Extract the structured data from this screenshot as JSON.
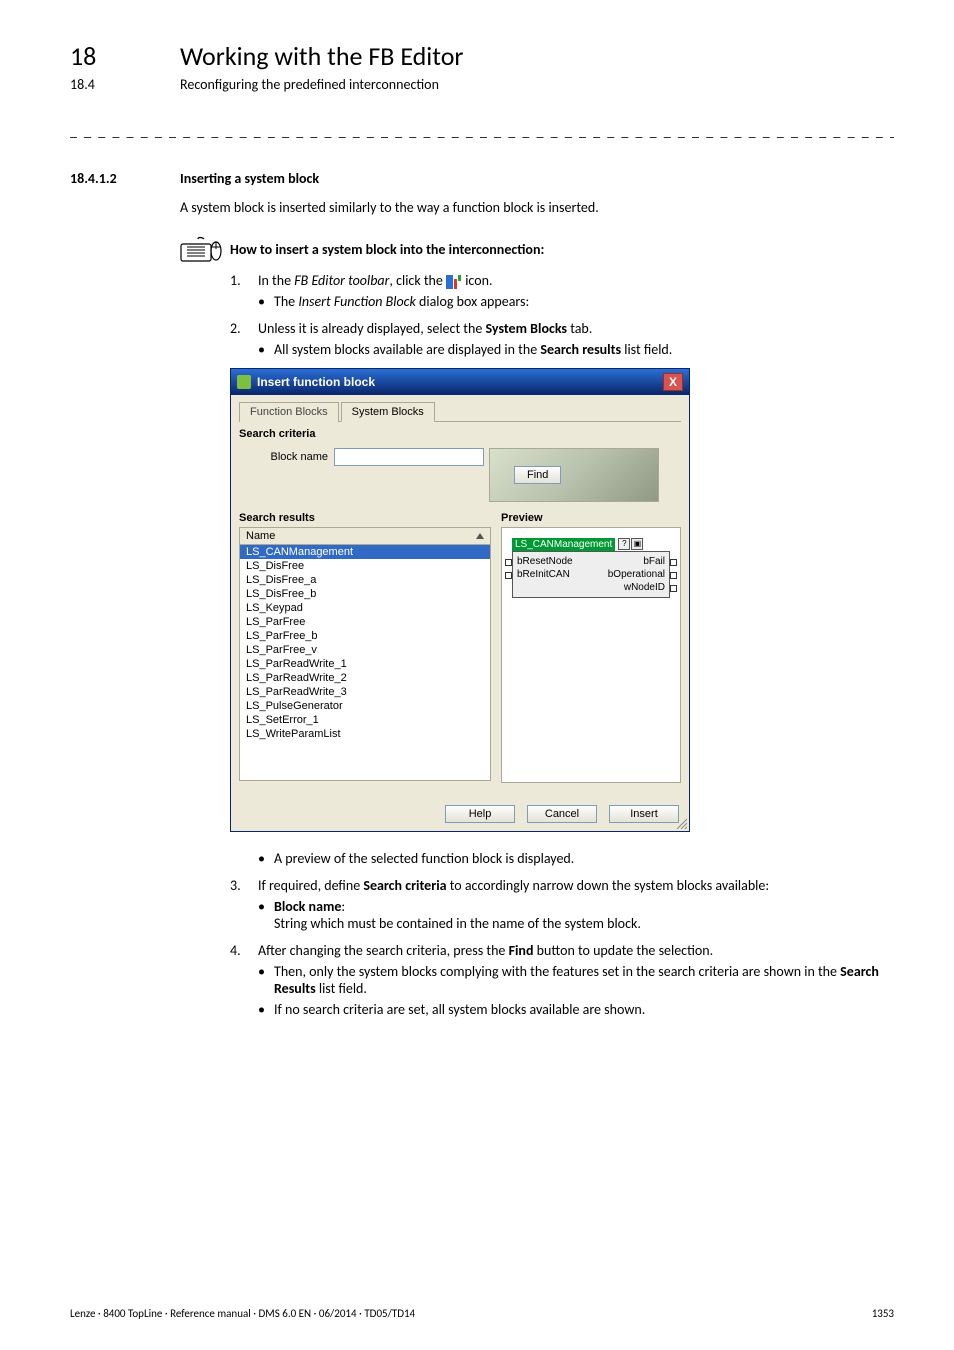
{
  "hdr": {
    "chapNo": "18",
    "chapTitle": "Working with the FB Editor",
    "secNo": "18.4",
    "secTitle": "Reconfiguring the predefined interconnection"
  },
  "subsec": {
    "no": "18.4.1.2",
    "title": "Inserting a system block"
  },
  "intro": "A system block is inserted similarly to the way a function block is inserted.",
  "howto": "How to insert a system block into the interconnection:",
  "step1": {
    "num": "1.",
    "pre": "In the ",
    "toolbar": "FB Editor toolbar",
    "mid": ", click the ",
    "post": " icon.",
    "b1a": "The ",
    "b1b": "Insert Function Block",
    "b1c": " dialog box appears:"
  },
  "step2": {
    "num": "2.",
    "pre": "Unless it is already displayed, select the ",
    "bold": "System Blocks",
    "post": " tab.",
    "b1a": "All system blocks available are displayed in the ",
    "b1b": "Search results",
    "b1c": " list field."
  },
  "dialog": {
    "title": "Insert function block",
    "close": "X",
    "tabFB": "Function Blocks",
    "tabSB": "System Blocks",
    "searchCriteria": "Search criteria",
    "blockName": "Block name",
    "findBtn": "Find",
    "searchResults": "Search results",
    "nameHdr": "Name",
    "items": [
      "LS_CANManagement",
      "LS_DisFree",
      "LS_DisFree_a",
      "LS_DisFree_b",
      "LS_Keypad",
      "LS_ParFree",
      "LS_ParFree_b",
      "LS_ParFree_v",
      "LS_ParReadWrite_1",
      "LS_ParReadWrite_2",
      "LS_ParReadWrite_3",
      "LS_PulseGenerator",
      "LS_SetError_1",
      "LS_WriteParamList"
    ],
    "previewLbl": "Preview",
    "blkTitle": "LS_CANManagement",
    "ports": {
      "l1": "bResetNode",
      "r1": "bFail",
      "l2": "bReInitCAN",
      "r2": "bOperational",
      "r3": "wNodeID"
    },
    "btnHelp": "Help",
    "btnCancel": "Cancel",
    "btnInsert": "Insert"
  },
  "afterDlg": {
    "b1": "A preview of the selected function block is displayed."
  },
  "step3": {
    "num": "3.",
    "pre": "If required, define ",
    "bold": "Search criteria",
    "post": " to accordingly narrow down the system blocks available:",
    "b1": "Block name",
    "b1post": ":",
    "b1line2": "String which must be contained in the name of the system block."
  },
  "step4": {
    "num": "4.",
    "pre": "After changing the search criteria, press the ",
    "bold": "Find",
    "post": " button to update the selection.",
    "b1a": "Then, only the system blocks complying with the features set in the search criteria are shown in the ",
    "b1b": "Search Results",
    "b1c": " list field.",
    "b2": "If no search criteria are set, all system blocks available are shown."
  },
  "footer": {
    "left": "Lenze · 8400 TopLine · Reference manual · DMS 6.0 EN · 06/2014 · TD05/TD14",
    "right": "1353"
  }
}
